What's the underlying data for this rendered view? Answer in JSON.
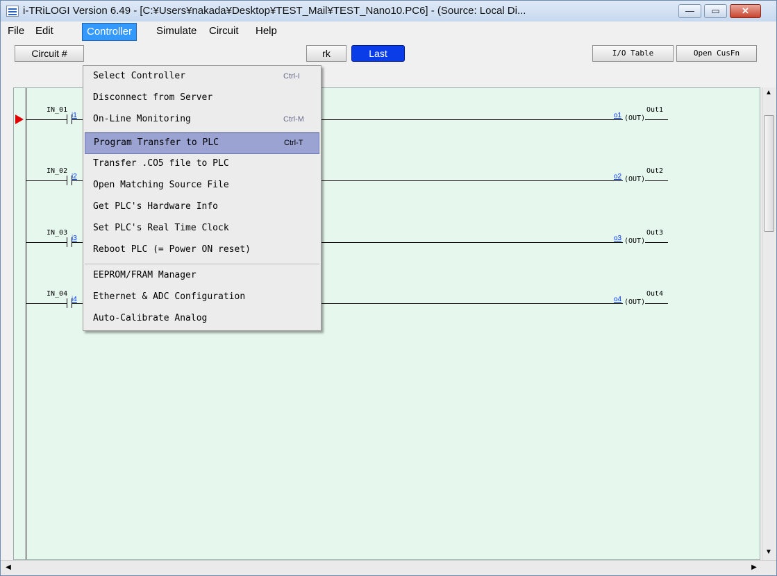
{
  "window": {
    "title": "i-TRiLOGI Version 6.49 - [C:¥Users¥nakada¥Desktop¥TEST_Mail¥TEST_Nano10.PC6] - (Source: Local Di...",
    "min_glyph": "—",
    "max_glyph": "▭",
    "close_glyph": "✕"
  },
  "menubar": [
    "File",
    "Edit",
    "Controller",
    "Simulate",
    "Circuit",
    "Help"
  ],
  "toolbar": {
    "circuit_label": "Circuit #",
    "mark_label": "rk",
    "last_label": "Last",
    "io_table_label": "I/O Table",
    "open_cusfn_label": "Open CusFn"
  },
  "controller_menu": {
    "items": [
      {
        "label": "Select Controller",
        "shortcut": "Ctrl-I"
      },
      {
        "label": "Disconnect from Server",
        "shortcut": ""
      },
      {
        "label": "On-Line Monitoring",
        "shortcut": "Ctrl-M"
      },
      {
        "label": "Program Transfer to PLC",
        "shortcut": "Ctrl-T"
      },
      {
        "label": "Transfer .CO5 file to PLC",
        "shortcut": ""
      },
      {
        "label": "Open Matching Source File",
        "shortcut": ""
      },
      {
        "label": "Get PLC's Hardware Info",
        "shortcut": ""
      },
      {
        "label": "Set PLC's Real Time Clock",
        "shortcut": ""
      },
      {
        "label": "Reboot PLC (= Power ON reset)",
        "shortcut": ""
      },
      {
        "label": "EEPROM/FRAM Manager",
        "shortcut": ""
      },
      {
        "label": "Ethernet & ADC Configuration",
        "shortcut": ""
      },
      {
        "label": "Auto-Calibrate Analog",
        "shortcut": ""
      }
    ],
    "highlighted_index": 3
  },
  "ladder": {
    "rungs": [
      {
        "input_name": "IN_01",
        "input_num": "i1",
        "output_name": "Out1",
        "output_num": "o1",
        "coil": "(OUT)"
      },
      {
        "input_name": "IN_02",
        "input_num": "i2",
        "output_name": "Out2",
        "output_num": "o2",
        "coil": "(OUT)"
      },
      {
        "input_name": "IN_03",
        "input_num": "i3",
        "output_name": "Out3",
        "output_num": "o3",
        "coil": "(OUT)"
      },
      {
        "input_name": "IN_04",
        "input_num": "i4",
        "output_name": "Out4",
        "output_num": "o4",
        "coil": "(OUT)"
      }
    ]
  },
  "scroll": {
    "up": "▲",
    "down": "▼",
    "left": "◀",
    "right": "▶"
  },
  "colors": {
    "canvas": "#e6f8ed",
    "menu_highlight": "#9aa3d1",
    "last_button": "#0a3de8",
    "pointer": "#e00000"
  }
}
